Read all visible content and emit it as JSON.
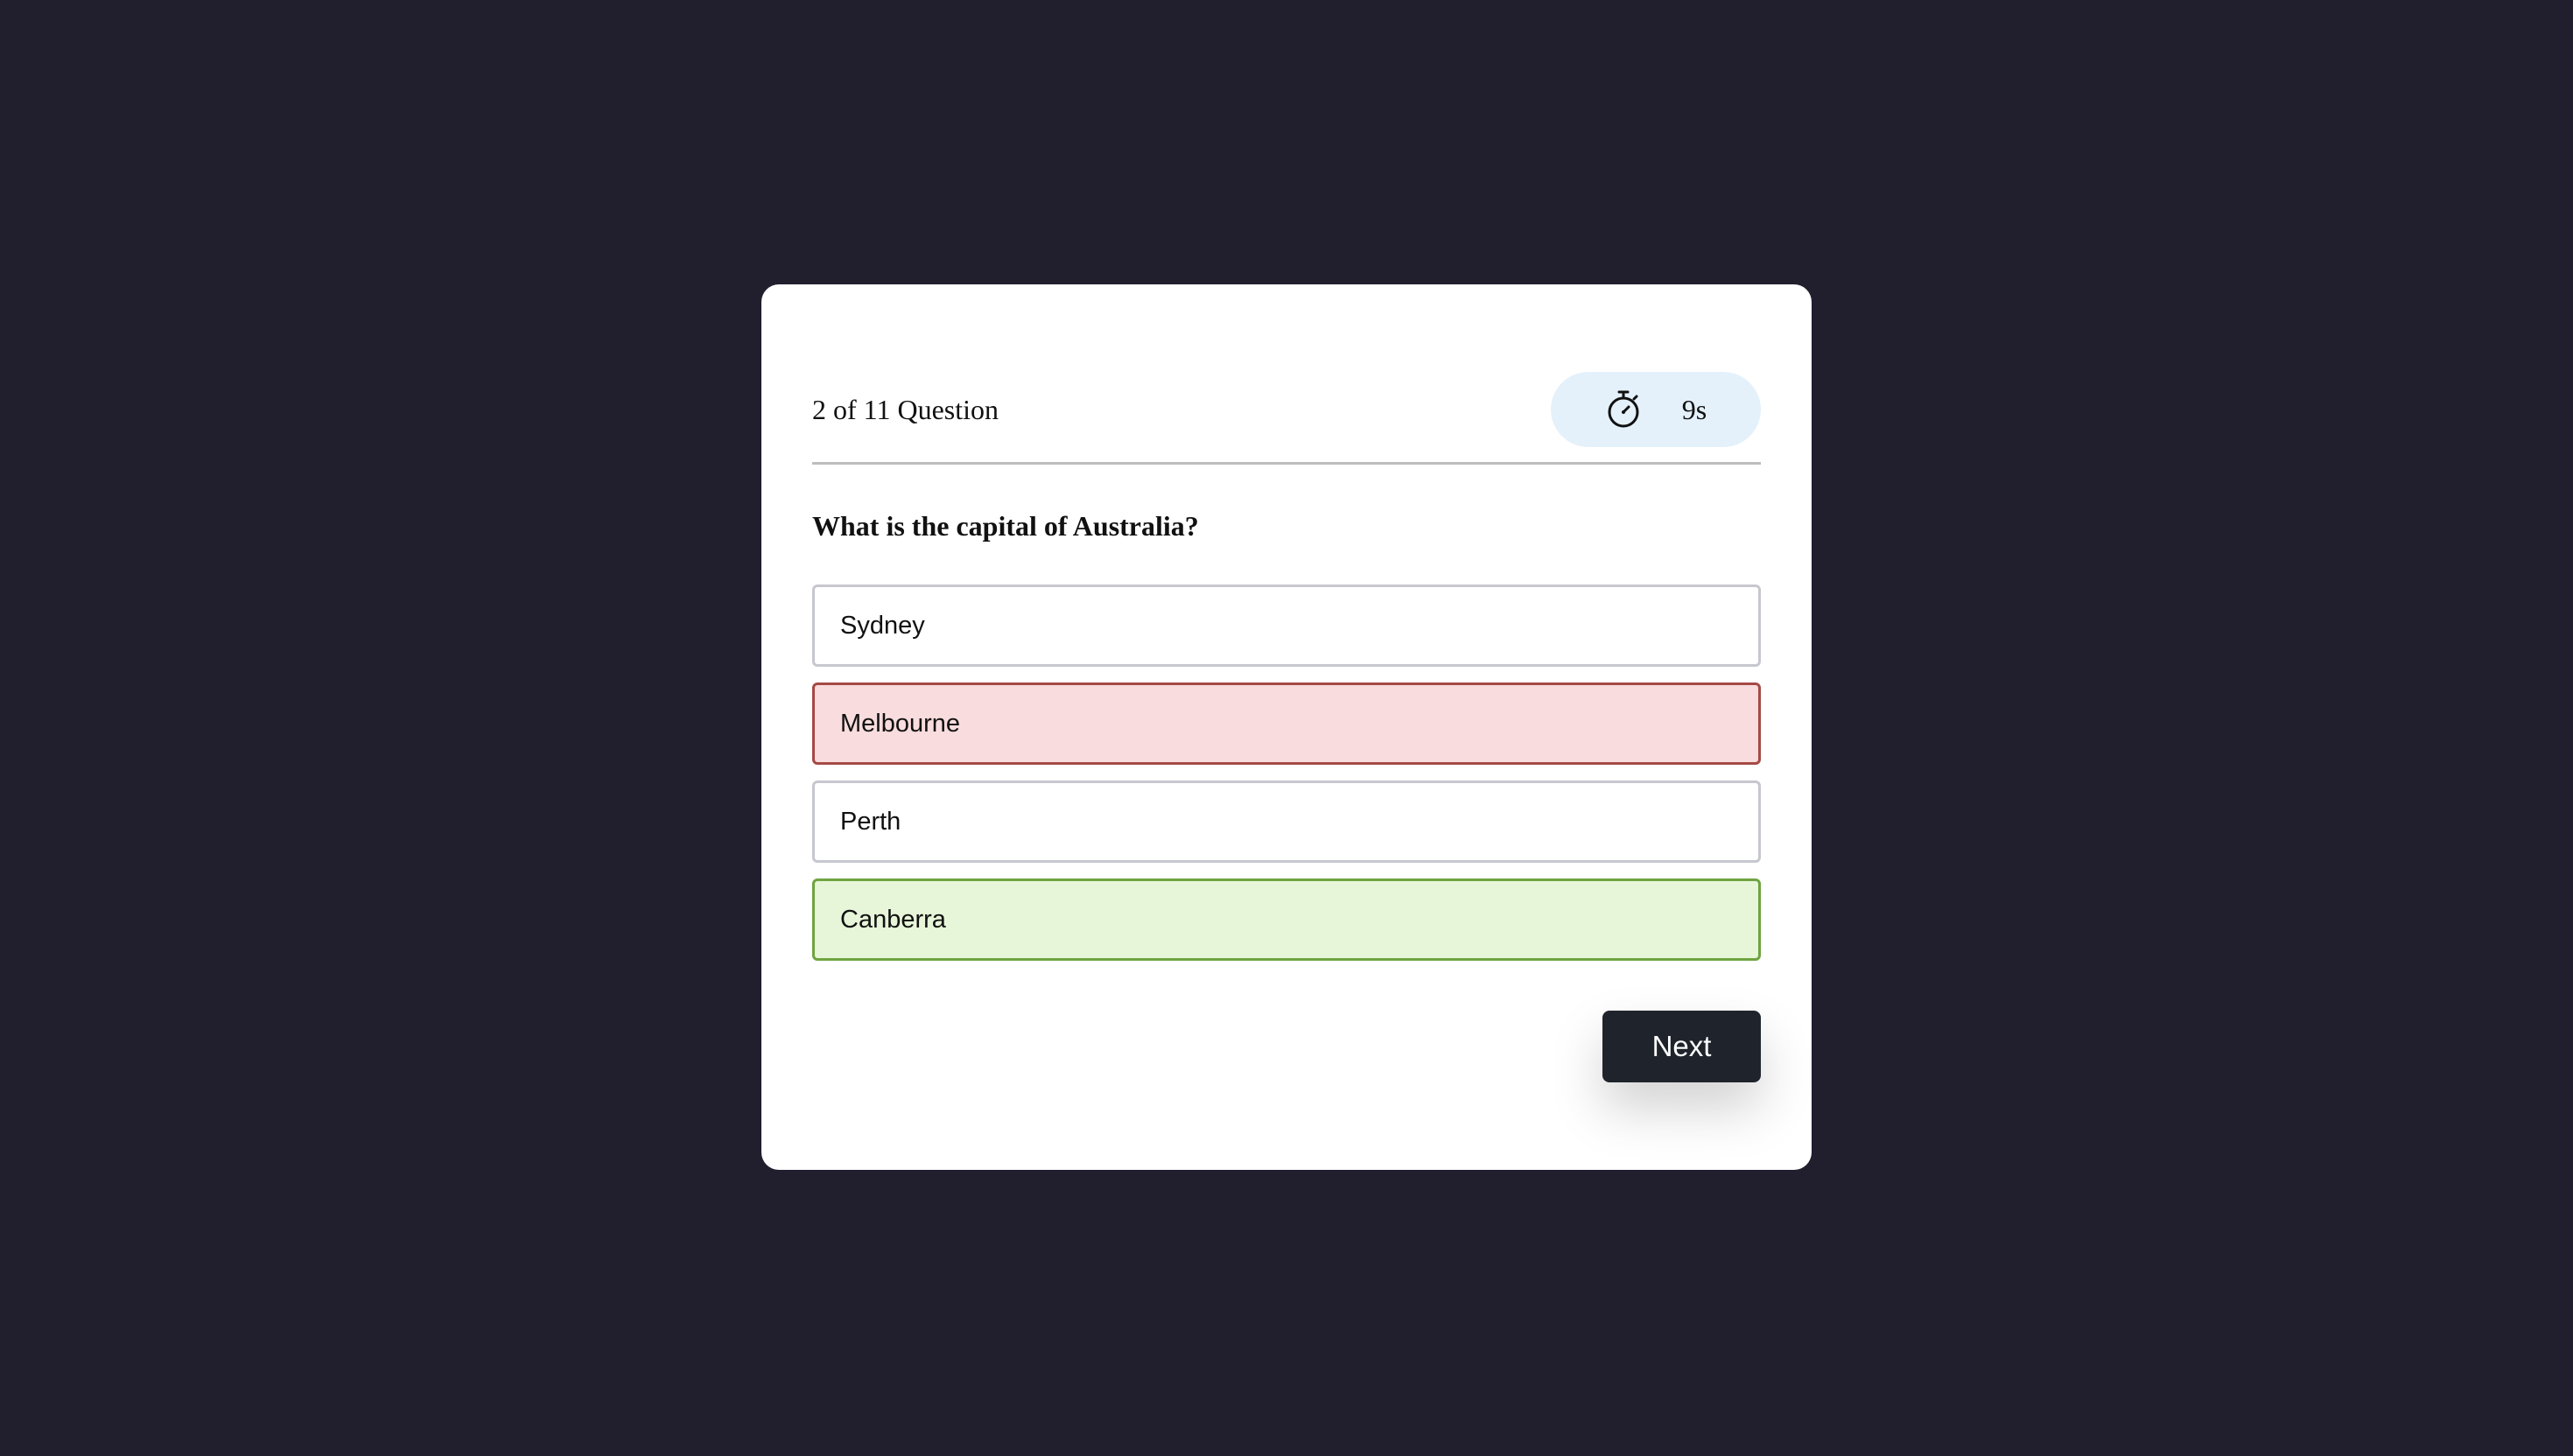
{
  "quiz": {
    "counter": "2 of 11 Question",
    "timer": {
      "icon": "stopwatch-icon",
      "value": "9s"
    },
    "question": "What is the capital of Australia?",
    "options": [
      {
        "label": "Sydney",
        "state": "default"
      },
      {
        "label": "Melbourne",
        "state": "wrong"
      },
      {
        "label": "Perth",
        "state": "default"
      },
      {
        "label": "Canberra",
        "state": "correct"
      }
    ],
    "next_label": "Next"
  },
  "colors": {
    "background": "#211e2e",
    "card": "#ffffff",
    "timer_bg": "#e4f1fb",
    "wrong_bg": "#f9dcdd",
    "wrong_border": "#a54a45",
    "correct_bg": "#e7f6d8",
    "correct_border": "#6ea441",
    "button": "#1f242c"
  }
}
